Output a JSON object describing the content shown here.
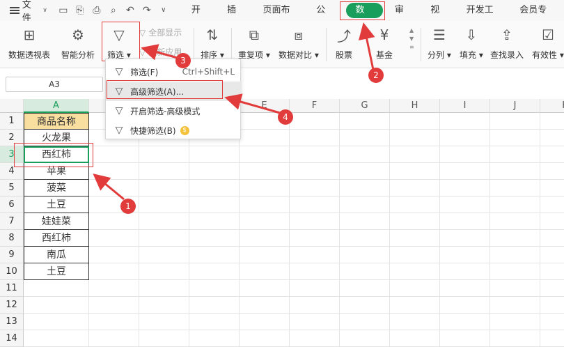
{
  "menubar": {
    "file_label": "文件",
    "tabs": [
      "开始",
      "插入",
      "页面布局",
      "公式",
      "数据",
      "审阅",
      "视图",
      "开发工具",
      "会员专享"
    ]
  },
  "ribbon": {
    "pivot": "数据透视表",
    "smart": "智能分析",
    "filter": "筛选",
    "show_all": "全部显示",
    "reapply": "重新应用",
    "sort": "排序",
    "dup": "重复项",
    "compare": "数据对比",
    "stock": "股票",
    "fund": "基金",
    "split": "分列",
    "fill": "填充",
    "lookup": "查找录入",
    "valid": "有效性"
  },
  "formula": {
    "namebox": "A3"
  },
  "dropdown": {
    "items": [
      {
        "label": "筛选(F)",
        "shortcut": "Ctrl+Shift+L"
      },
      {
        "label": "高级筛选(A)...",
        "shortcut": ""
      },
      {
        "label": "开启筛选-高级模式",
        "shortcut": ""
      },
      {
        "label": "快捷筛选(B)",
        "shortcut": ""
      }
    ]
  },
  "grid": {
    "columns": [
      "A",
      "B",
      "C",
      "D",
      "E",
      "F",
      "G",
      "H",
      "I",
      "J",
      "K"
    ],
    "rows": [
      "1",
      "2",
      "3",
      "4",
      "5",
      "6",
      "7",
      "8",
      "9",
      "10",
      "11",
      "12",
      "13",
      "14"
    ],
    "header_cell": "商品名称",
    "values": [
      "火龙果",
      "西红柿",
      "苹果",
      "菠菜",
      "土豆",
      "娃娃菜",
      "西红柿",
      "南瓜",
      "土豆"
    ]
  },
  "annotations": [
    "1",
    "2",
    "3",
    "4"
  ],
  "colors": {
    "accent": "#1a9e5c",
    "marker": "#e23b3b",
    "header_fill": "#f8dfa0"
  }
}
